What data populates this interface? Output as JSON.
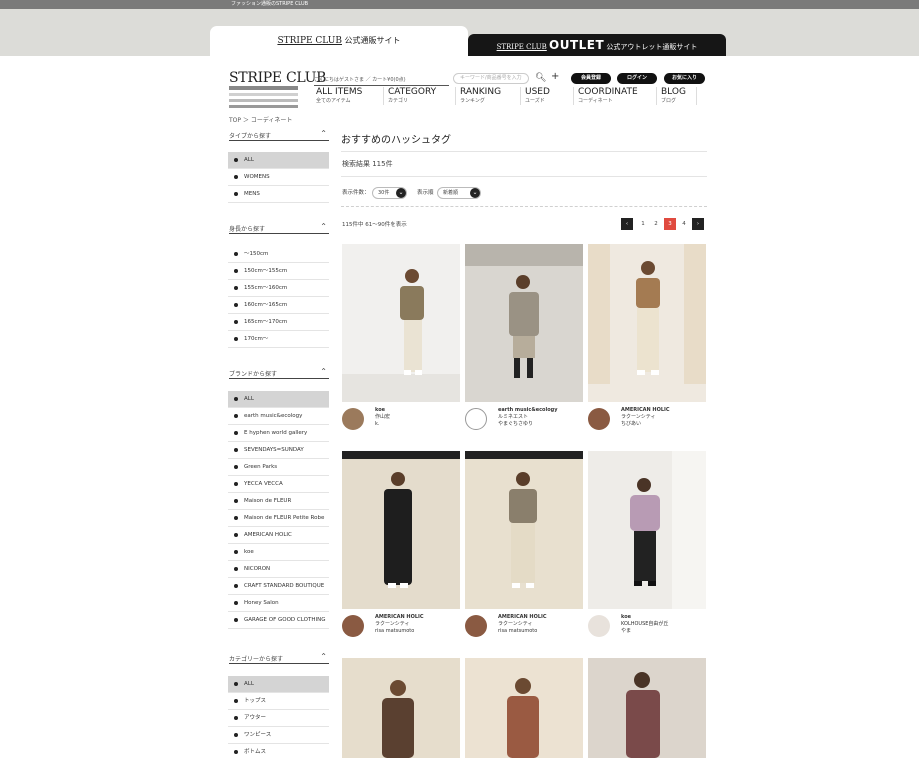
{
  "topbar": {
    "text": "ファッション通販のSTRIPE CLUB"
  },
  "tabs": {
    "main": {
      "logo": "STRIPE CLUB",
      "suffix": "公式通販サイト"
    },
    "outlet": {
      "logo": "STRIPE CLUB",
      "big": "OUTLET",
      "suffix": "公式アウトレット通販サイト"
    }
  },
  "header": {
    "brand": "STRIPE CLUB",
    "links": "こんにちはゲストさま ／ カート¥0(0点)",
    "search_placeholder": "キーワード/商品番号を入力",
    "buttons": [
      "会員登録",
      "ログイン",
      "お気に入り"
    ],
    "nav": [
      {
        "en": "ALL ITEMS",
        "jp": "全てのアイテム"
      },
      {
        "en": "CATEGORY",
        "jp": "カテゴリ"
      },
      {
        "en": "RANKING",
        "jp": "ランキング"
      },
      {
        "en": "USED",
        "jp": "ユーズド"
      },
      {
        "en": "COORDINATE",
        "jp": "コーディネート"
      },
      {
        "en": "BLOG",
        "jp": "ブログ"
      }
    ]
  },
  "breadcrumb": "TOP  ＞  コーディネート",
  "sidebar": {
    "type": {
      "title": "タイプから探す",
      "items": [
        "ALL",
        "WOMENS",
        "MENS"
      ]
    },
    "height": {
      "title": "身長から探す",
      "items": [
        "～150cm",
        "150cm～155cm",
        "155cm～160cm",
        "160cm～165cm",
        "165cm～170cm",
        "170cm～"
      ]
    },
    "brand": {
      "title": "ブランドから探す",
      "items": [
        "ALL",
        "earth music&ecology",
        "E hyphen world gallery",
        "SEVENDAYS=SUNDAY",
        "Green Parks",
        "YECCA VECCA",
        "Maison de FLEUR",
        "Maison de FLEUR Petite Robe",
        "AMERICAN HOLIC",
        "koe",
        "NICORON",
        "CRAFT STANDARD BOUTIQUE",
        "Honey Salon",
        "GARAGE OF GOOD CLOTHING"
      ]
    },
    "category": {
      "title": "カテゴリーから探す",
      "items": [
        "ALL",
        "トップス",
        "アウター",
        "ワンピース",
        "ボトムス"
      ]
    }
  },
  "main": {
    "title": "おすすめのハッシュタグ",
    "result": "検索結果 115件",
    "display_count_label": "表示件数：",
    "display_count_value": "30件",
    "display_order_label": "表示順",
    "display_order_value": "新着順",
    "count_text": "115件中 61～90件を表示",
    "pagination": [
      "1",
      "2",
      "3",
      "4"
    ]
  },
  "cards": [
    {
      "brand": "koe",
      "line2": "作山宏",
      "line3": "k."
    },
    {
      "brand": "earth music&ecology",
      "line2": "ルミネエスト",
      "line3": "やまぐちさゆり"
    },
    {
      "brand": "AMERICAN HOLIC",
      "line2": "ラクーンシティ",
      "line3": "ちびあい"
    },
    {
      "brand": "AMERICAN HOLIC",
      "line2": "ラクーンシティ",
      "line3": "risa matsumoto"
    },
    {
      "brand": "AMERICAN HOLIC",
      "line2": "ラクーンシティ",
      "line3": "risa matsumoto"
    },
    {
      "brand": "koe",
      "line2": "KOLHOUSE自由が丘",
      "line3": "やま"
    },
    {
      "brand": "",
      "line2": "",
      "line3": ""
    },
    {
      "brand": "",
      "line2": "",
      "line3": ""
    },
    {
      "brand": "",
      "line2": "",
      "line3": ""
    }
  ],
  "colors": {
    "accent": "#e04a3f",
    "dark": "#161616",
    "band": "#dcdcd8"
  }
}
